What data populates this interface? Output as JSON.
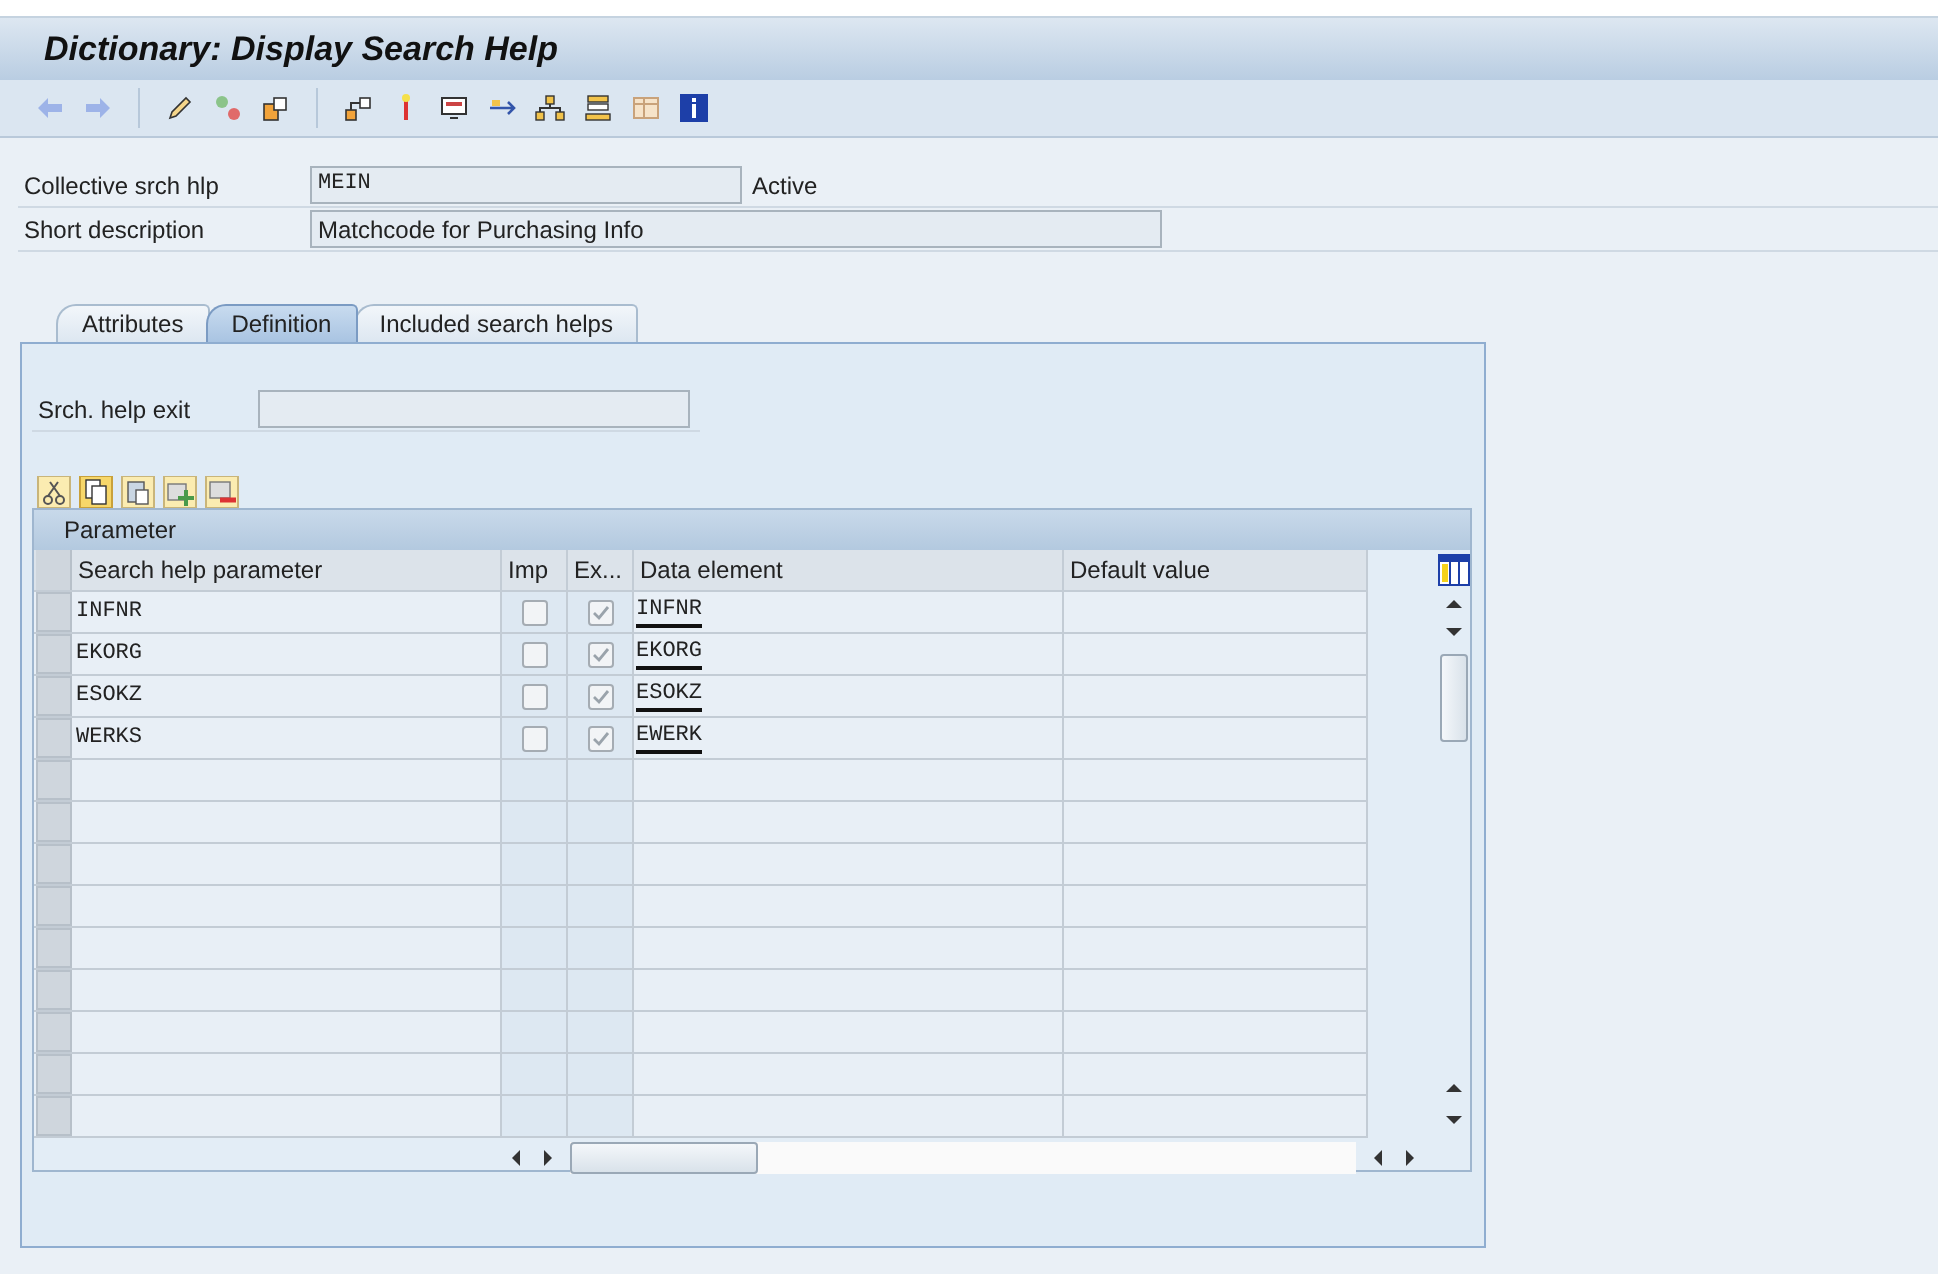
{
  "window": {
    "title": "Dictionary: Display Search Help"
  },
  "header_fields": [
    {
      "label": "Collective srch hlp",
      "value": "MEIN",
      "status": "Active"
    },
    {
      "label": "Short description",
      "value": "Matchcode for Purchasing Info"
    }
  ],
  "tabs": [
    {
      "label": "Attributes",
      "selected": false
    },
    {
      "label": "Definition",
      "selected": true
    },
    {
      "label": "Included search helps",
      "selected": false
    }
  ],
  "exit_field": {
    "label": "Srch. help exit"
  },
  "table": {
    "title": "Parameter",
    "columns": [
      "Search help parameter",
      "Imp",
      "Ex...",
      "Data element",
      "Default value"
    ],
    "rows": [
      {
        "parameter": "INFNR",
        "imp": false,
        "exp": true,
        "data_element": "INFNR"
      },
      {
        "parameter": "EKORG",
        "imp": false,
        "exp": true,
        "data_element": "EKORG"
      },
      {
        "parameter": "ESOKZ",
        "imp": false,
        "exp": true,
        "data_element": "ESOKZ"
      },
      {
        "parameter": "WERKS",
        "imp": false,
        "exp": true,
        "data_element": "EWERK"
      }
    ]
  }
}
